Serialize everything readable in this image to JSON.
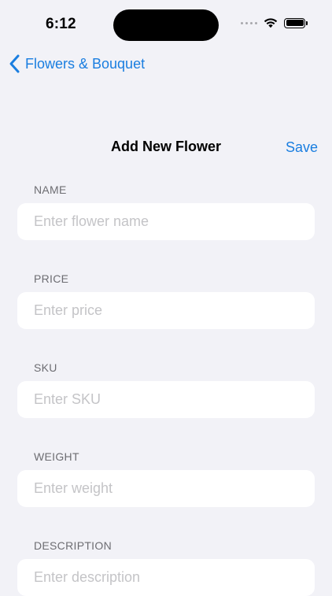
{
  "status_bar": {
    "time": "6:12"
  },
  "nav": {
    "back_label": "Flowers & Bouquet"
  },
  "form": {
    "title": "Add New Flower",
    "save_label": "Save",
    "fields": [
      {
        "label": "NAME",
        "placeholder": "Enter flower name",
        "value": ""
      },
      {
        "label": "PRICE",
        "placeholder": "Enter price",
        "value": ""
      },
      {
        "label": "SKU",
        "placeholder": "Enter SKU",
        "value": ""
      },
      {
        "label": "WEIGHT",
        "placeholder": "Enter weight",
        "value": ""
      },
      {
        "label": "DESCRIPTION",
        "placeholder": "Enter description",
        "value": ""
      }
    ]
  },
  "icons": {
    "back": "chevron-left-icon",
    "cellular": "cellular-dots-icon",
    "wifi": "wifi-icon",
    "battery": "battery-icon"
  },
  "colors": {
    "accent": "#1a7ee0",
    "background": "#f2f2f7",
    "field_background": "#ffffff",
    "label": "#6d6d72",
    "placeholder": "#c4c4c7"
  }
}
